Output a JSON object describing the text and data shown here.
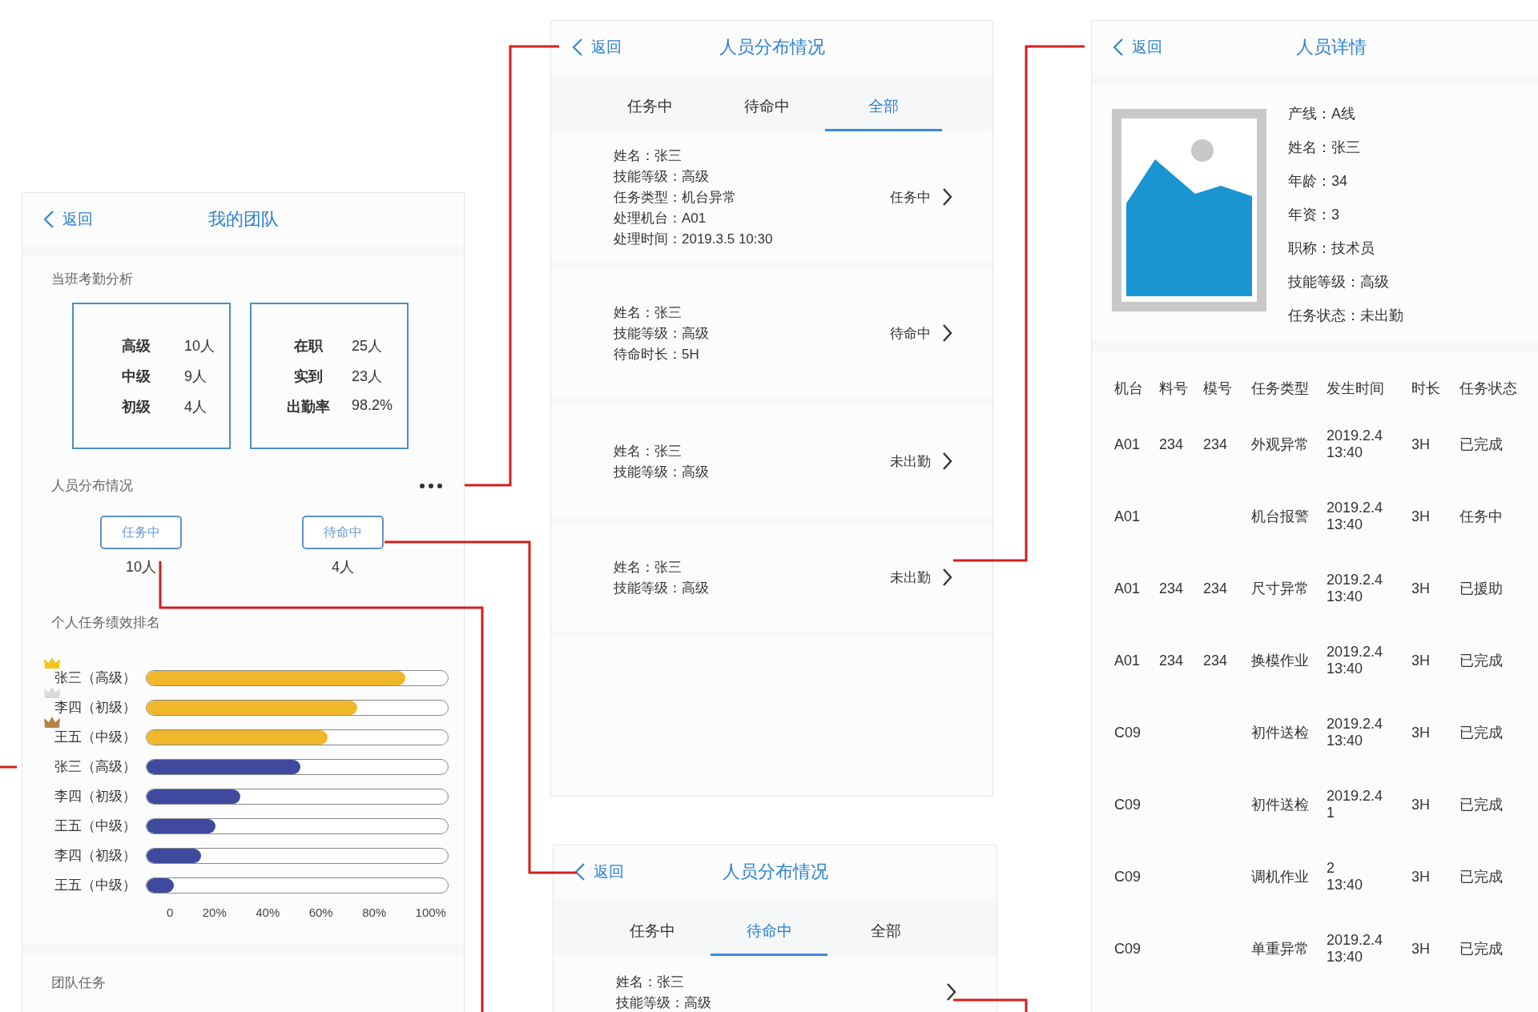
{
  "team_screen": {
    "back": "返回",
    "title": "我的团队",
    "attendance": {
      "title": "当班考勤分析",
      "boxes": [
        [
          {
            "label": "高级",
            "value": "10人"
          },
          {
            "label": "中级",
            "value": "9人"
          },
          {
            "label": "初级",
            "value": "4人"
          }
        ],
        [
          {
            "label": "在职",
            "value": "25人"
          },
          {
            "label": "实到",
            "value": "23人"
          },
          {
            "label": "出勤率",
            "value": "98.2%"
          }
        ]
      ]
    },
    "distribution": {
      "title": "人员分布情况",
      "statuses": [
        {
          "label": "任务中",
          "count": "10人"
        },
        {
          "label": "待命中",
          "count": "4人"
        }
      ]
    },
    "ranking": {
      "title": "个人任务绩效排名",
      "rows": [
        {
          "label": "张三（高级）",
          "level": 0.86,
          "color": "#f0b72a",
          "crown": {
            "color": "#f5c518"
          }
        },
        {
          "label": "李四（初级）",
          "level": 0.7,
          "color": "#f0b72a",
          "crown": {
            "color": "#d9d9d9"
          }
        },
        {
          "label": "王五（中级）",
          "level": 0.6,
          "color": "#f0b72a",
          "crown": {
            "color": "#b5824a"
          }
        },
        {
          "label": "张三（高级）",
          "level": 0.51,
          "color": "#3f4a9e"
        },
        {
          "label": "李四（初级）",
          "level": 0.31,
          "color": "#3f4a9e"
        },
        {
          "label": "王五（中级）",
          "level": 0.23,
          "color": "#3f4a9e"
        },
        {
          "label": "李四（初级）",
          "level": 0.18,
          "color": "#3f4a9e"
        },
        {
          "label": "王五（中级）",
          "level": 0.09,
          "color": "#3f4a9e"
        }
      ],
      "axis": [
        "0",
        "20%",
        "40%",
        "60%",
        "80%",
        "100%"
      ]
    },
    "team_tasks": {
      "title": "团队任务"
    }
  },
  "distribution_screen": {
    "back": "返回",
    "title": "人员分布情况",
    "tabs": [
      {
        "label": "任务中",
        "selected": false
      },
      {
        "label": "待命中",
        "selected": false
      },
      {
        "label": "全部",
        "selected": true
      }
    ],
    "items": [
      {
        "lines": [
          "姓名：张三",
          "技能等级：高级",
          "任务类型：机台异常",
          "处理机台：A01",
          "处理时间：2019.3.5 10:30"
        ],
        "status": "任务中"
      },
      {
        "lines": [
          "姓名：张三",
          "技能等级：高级",
          "待命时长：5H"
        ],
        "status": "待命中"
      },
      {
        "lines": [
          "姓名：张三",
          "技能等级：高级"
        ],
        "status": "未出勤"
      },
      {
        "lines": [
          "姓名：张三",
          "技能等级：高级"
        ],
        "status": "未出勤"
      }
    ]
  },
  "standby_screen": {
    "back": "返回",
    "title": "人员分布情况",
    "tabs": [
      {
        "label": "任务中",
        "selected": false
      },
      {
        "label": "待命中",
        "selected": true
      },
      {
        "label": "全部",
        "selected": false
      }
    ],
    "items": [
      {
        "lines": [
          "姓名：张三",
          "技能等级：高级"
        ]
      }
    ]
  },
  "detail_screen": {
    "back": "返回",
    "title": "人员详情",
    "fields": [
      "产线：A线",
      "姓名：张三",
      "年龄：34",
      "年资：3",
      "职称：技术员",
      "技能等级：高级",
      "任务状态：未出勤"
    ],
    "table": {
      "columns": [
        "机台",
        "料号",
        "模号",
        "任务类型",
        "发生时间",
        "时长",
        "任务状态"
      ],
      "rows": [
        {
          "machine": "A01",
          "material": "234",
          "mold": "234",
          "type": "外观异常",
          "time": [
            "2019.2.4",
            "13:40"
          ],
          "duration": "3H",
          "status": "已完成"
        },
        {
          "machine": "A01",
          "type": "机台报警",
          "time": [
            "2019.2.4",
            "13:40"
          ],
          "duration": "3H",
          "status": "任务中"
        },
        {
          "machine": "A01",
          "material": "234",
          "mold": "234",
          "type": "尺寸异常",
          "time": [
            "2019.2.4",
            "13:40"
          ],
          "duration": "3H",
          "status": "已援助"
        },
        {
          "machine": "A01",
          "material": "234",
          "mold": "234",
          "type": "换模作业",
          "time": [
            "2019.2.4",
            "13:40"
          ],
          "duration": "3H",
          "status": "已完成"
        },
        {
          "machine": "C09",
          "type": "初件送检",
          "time": [
            "2019.2.4",
            "13:40"
          ],
          "duration": "3H",
          "status": "已完成"
        },
        {
          "machine": "C09",
          "type": "初件送检",
          "time": [
            "2019.2.4",
            "1"
          ],
          "duration": "3H",
          "status": "已完成"
        },
        {
          "machine": "C09",
          "type": "调机作业",
          "time": [
            "2",
            "13:40"
          ],
          "duration": "3H",
          "status": "已完成"
        },
        {
          "machine": "C09",
          "type": "单重异常",
          "time": [
            "2019.2.4",
            "13:40"
          ],
          "duration": "3H",
          "status": "已完成"
        }
      ]
    }
  }
}
